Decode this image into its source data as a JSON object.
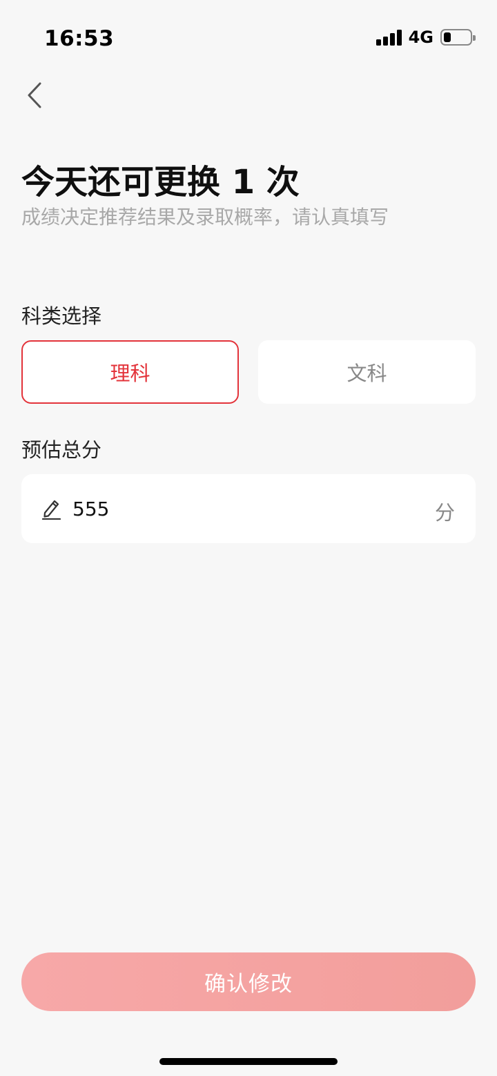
{
  "status_bar": {
    "time": "16:53",
    "network": "4G",
    "battery_level": 0.28,
    "signal_bars": 4
  },
  "header": {
    "back_icon": "chevron-left-icon",
    "title": "今天还可更换 1 次",
    "subtitle": "成绩决定推荐结果及录取概率，请认真填写"
  },
  "category": {
    "label": "科类选择",
    "options": [
      {
        "label": "理科",
        "selected": true
      },
      {
        "label": "文科",
        "selected": false
      }
    ]
  },
  "score": {
    "label": "预估总分",
    "value": "555",
    "unit": "分",
    "icon": "edit-pencil-icon"
  },
  "confirm_button": {
    "label": "确认修改"
  },
  "colors": {
    "accent": "#e3333a",
    "button_bg_start": "#f7a8a8",
    "button_bg_end": "#f29e9b",
    "page_bg": "#f7f7f7"
  }
}
